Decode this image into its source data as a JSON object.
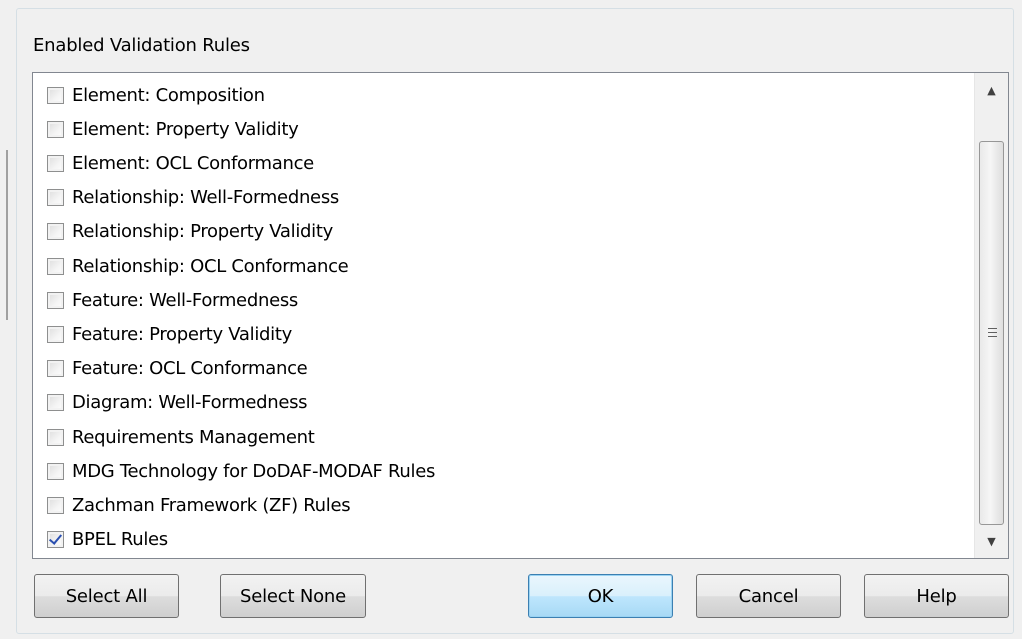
{
  "group_label": "Enabled Validation Rules",
  "rules": [
    {
      "label": "Element: Composition",
      "checked": false
    },
    {
      "label": "Element: Property Validity",
      "checked": false
    },
    {
      "label": "Element: OCL Conformance",
      "checked": false
    },
    {
      "label": "Relationship: Well-Formedness",
      "checked": false
    },
    {
      "label": "Relationship: Property Validity",
      "checked": false
    },
    {
      "label": "Relationship: OCL Conformance",
      "checked": false
    },
    {
      "label": "Feature: Well-Formedness",
      "checked": false
    },
    {
      "label": "Feature: Property Validity",
      "checked": false
    },
    {
      "label": "Feature: OCL Conformance",
      "checked": false
    },
    {
      "label": "Diagram: Well-Formedness",
      "checked": false
    },
    {
      "label": "Requirements Management",
      "checked": false
    },
    {
      "label": "MDG Technology for DoDAF-MODAF Rules",
      "checked": false
    },
    {
      "label": "Zachman Framework (ZF) Rules",
      "checked": false
    },
    {
      "label": "BPEL Rules",
      "checked": true
    }
  ],
  "scrollbar": {
    "up_arrow": "▲",
    "down_arrow": "▼"
  },
  "buttons": {
    "select_all": "Select All",
    "select_none": "Select None",
    "ok": "OK",
    "cancel": "Cancel",
    "help": "Help"
  }
}
